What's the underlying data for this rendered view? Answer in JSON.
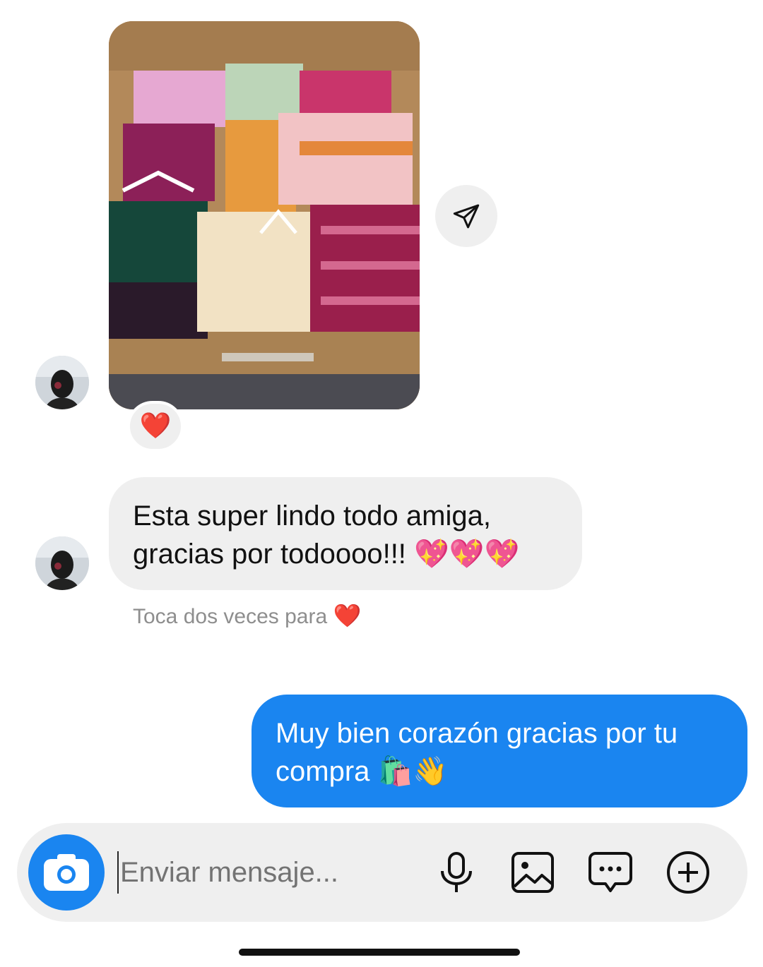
{
  "thread": {
    "photo_message": {
      "alt": "Caja de cartón con ropa doblada",
      "reaction": "❤️"
    },
    "incoming_message": {
      "line1": "Esta super lindo todo amiga,",
      "line2": "gracias por todoooo!!!",
      "emojis": "💖💖💖"
    },
    "hint": {
      "text": "Toca dos veces para",
      "icon": "❤️"
    },
    "outgoing_message": {
      "line1": "Muy bien corazón gracias por tu",
      "line2": "compra",
      "emojis": "🛍️👋"
    }
  },
  "composer": {
    "placeholder": "Enviar mensaje...",
    "icons": [
      "camera-icon",
      "microphone-icon",
      "gallery-icon",
      "sticker-icon",
      "plus-icon"
    ]
  },
  "colors": {
    "accent": "#1a85f0",
    "bubble_in": "#efefef",
    "hint_text": "#8e8e8e",
    "heart": "#ed1c34"
  }
}
